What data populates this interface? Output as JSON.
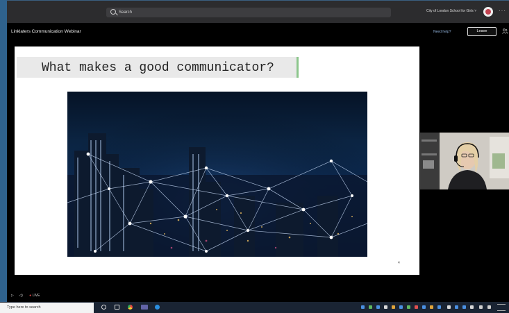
{
  "topbar": {
    "search_placeholder": "Search",
    "org_name": "City of London School for Girls",
    "org_chevron": "˅",
    "more": "···"
  },
  "meeting": {
    "title": "Linklaters Communication Webinar",
    "need_help": "Need help?",
    "leave": "Leave"
  },
  "slide": {
    "title": "What makes a good communicator?",
    "page_number": "4"
  },
  "controls": {
    "play": "▷",
    "volume": "◁)",
    "live": "LIVE"
  },
  "taskbar": {
    "search_placeholder": "Type here to search"
  }
}
